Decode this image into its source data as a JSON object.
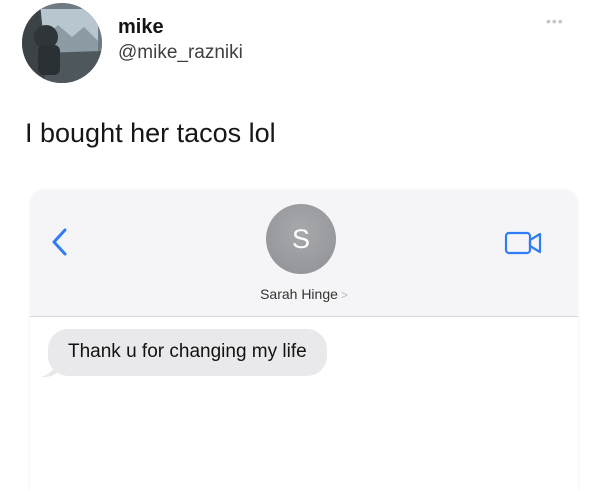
{
  "tweet": {
    "author_name": "mike",
    "author_handle": "@mike_razniki",
    "more_icon": "more-dots-icon",
    "text": "I bought her tacos lol"
  },
  "message_screenshot": {
    "back_icon": "chevron-left-icon",
    "contact_initial": "S",
    "contact_name": "Sarah Hinge",
    "contact_chevron": ">",
    "video_icon": "video-camera-icon",
    "messages": [
      {
        "direction": "received",
        "text": "Thank u for changing my life"
      }
    ]
  },
  "colors": {
    "accent_blue": "#2f7cf6",
    "bubble_gray": "#e9e9eb",
    "header_gray": "#f5f5f7",
    "contact_avatar_gray": "#9b9ca1"
  }
}
